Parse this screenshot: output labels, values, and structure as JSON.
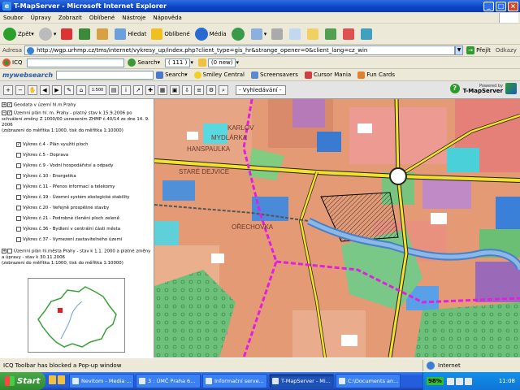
{
  "window": {
    "title": "T-MapServer - Microsoft Internet Explorer"
  },
  "menu": [
    "Soubor",
    "Úpravy",
    "Zobrazit",
    "Oblíbené",
    "Nástroje",
    "Nápověda"
  ],
  "toolbar": {
    "back": "Zpět",
    "search": "Hledat",
    "favorites": "Oblíbené",
    "media": "Média"
  },
  "address": {
    "label": "Adresa",
    "url": "http://wgp.urhmp.cz/tms/internet/vykresy_up/index.php?client_type=gis_hr&strange_opener=0&client_lang=cz_win",
    "go": "Přejít",
    "links": "Odkazy"
  },
  "icq": {
    "label": "ICQ",
    "search": "Search",
    "counter": "( 111 )",
    "new": "(0 new)"
  },
  "mywebsearch": {
    "logo": "mywebsearch",
    "search": "Search",
    "smiley": "Smiley Central",
    "screensavers": "Screensavers",
    "cursor": "Cursor Mania",
    "fun": "Fun Cards"
  },
  "maptools": {
    "scale": "1:500",
    "search_select": "- Vyhledávání -",
    "powered_line1": "Powered by",
    "powered_line2": "T-MapServer"
  },
  "layers": {
    "geodata": "Geodata v území hl.m.Prahy",
    "plan_title": "Územní plán hl. m. Prahy - platný stav k 15.9.2006 po schválení změny Z 1000/00 usnesením ZHMP č.40/14 ze dne 14. 9. 2006",
    "plan_scale": "(zobrazení do měřítka 1:1000, tisk do měřítka 1:10000)",
    "items": [
      {
        "label": "Výkres č.4 - Plán využití ploch",
        "checked": true
      },
      {
        "label": "Výkres č.5 - Doprava",
        "checked": false
      },
      {
        "label": "Výkres č.9 - Vodní hospodářství a odpady",
        "checked": false
      },
      {
        "label": "Výkres č.10 - Energetika",
        "checked": false
      },
      {
        "label": "Výkres č.11 - Přenos informací a telekomy",
        "checked": false
      },
      {
        "label": "Výkres č.19 - Územní systém ekologické stability",
        "checked": false
      },
      {
        "label": "Výkres č.20 - Veřejně prospěšné stavby",
        "checked": false
      },
      {
        "label": "Výkres č.21 - Podrobné členění ploch zeleně",
        "checked": false
      },
      {
        "label": "Výkres č.36 - Bydlení v centrální části města",
        "checked": false
      },
      {
        "label": "Výkres č.37 - Vymezení zastavitelného území",
        "checked": false
      }
    ],
    "plan2_title": "Územní plán hl.města Prahy - stav k 1.1. 2000 a platné změny a úpravy - stav k 30.11.2006",
    "plan2_scale": "(zobrazení do měřítka 1:1000, tisk do měřítka 1:10000)"
  },
  "map_labels": {
    "karlov": "KARLOV",
    "mydlarka": "MYDLÁRKA",
    "hanspaul": "HANSPAULKA",
    "stare": "STARÉ DEJVICE",
    "orechovka": "OŘECHOVKA"
  },
  "status": {
    "text": "ICQ Toolbar has blocked a Pop-up window",
    "zone": "Internet"
  },
  "taskbar": {
    "start": "Start",
    "tasks": [
      {
        "label": "Nevitom - Media ...",
        "active": false
      },
      {
        "label": "3 : ÚMČ Praha 6...",
        "active": false
      },
      {
        "label": "Informační serve...",
        "active": false
      },
      {
        "label": "T-MapServer - Mi...",
        "active": true
      },
      {
        "label": "C:\\Documents an...",
        "active": false
      }
    ],
    "battery": "98%",
    "clock": "11:08"
  }
}
